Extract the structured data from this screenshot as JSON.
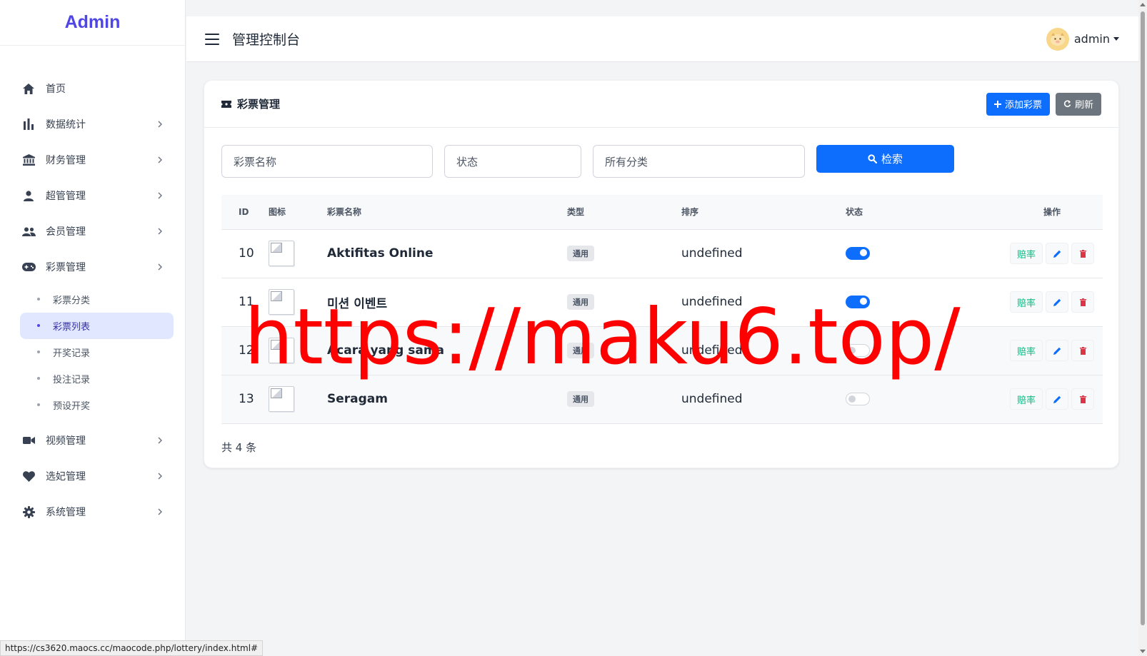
{
  "sidebar": {
    "logo": "Admin",
    "items": [
      {
        "label": "首页",
        "icon": "home-icon"
      },
      {
        "label": "数据统计",
        "icon": "bar-chart-icon"
      },
      {
        "label": "财务管理",
        "icon": "bank-icon"
      },
      {
        "label": "超管管理",
        "icon": "user-icon"
      },
      {
        "label": "会员管理",
        "icon": "users-icon"
      },
      {
        "label": "彩票管理",
        "icon": "gamepad-icon"
      },
      {
        "label": "视频管理",
        "icon": "video-icon"
      },
      {
        "label": "选妃管理",
        "icon": "heart-icon"
      },
      {
        "label": "系统管理",
        "icon": "gear-icon"
      }
    ],
    "subitems": [
      {
        "label": "彩票分类"
      },
      {
        "label": "彩票列表"
      },
      {
        "label": "开奖记录"
      },
      {
        "label": "投注记录"
      },
      {
        "label": "预设开奖"
      }
    ],
    "active_subitem": "彩票列表"
  },
  "header": {
    "title": "管理控制台",
    "username": "admin"
  },
  "card": {
    "title": "彩票管理",
    "add_button": "添加彩票",
    "refresh_button": "刷新"
  },
  "filters": {
    "name_placeholder": "彩票名称",
    "status_placeholder": "状态",
    "category_placeholder": "所有分类",
    "search_button": "检索"
  },
  "table": {
    "headers": [
      "ID",
      "图标",
      "彩票名称",
      "类型",
      "排序",
      "状态",
      "操作"
    ],
    "rows": [
      {
        "id": "10",
        "name": "Aktifitas Online",
        "type": "通用",
        "sort": "undefined",
        "status": true,
        "rate_label": "赔率"
      },
      {
        "id": "11",
        "name": "미션 이벤트",
        "type": "通用",
        "sort": "undefined",
        "status": true,
        "rate_label": "赔率"
      },
      {
        "id": "12",
        "name": "Acara yang sama",
        "type": "通用",
        "sort": "undefined",
        "status": false,
        "rate_label": "赔率"
      },
      {
        "id": "13",
        "name": "Seragam",
        "type": "通用",
        "sort": "undefined",
        "status": false,
        "rate_label": "赔率"
      }
    ]
  },
  "footer": {
    "total": "共 4 条"
  },
  "watermark": "https://maku6.top/",
  "statusbar_url": "https://cs3620.maocs.cc/maocode.php/lottery/index.html#",
  "colors": {
    "accent": "#4f46e5",
    "primary": "#0d6efd",
    "secondary": "#6c757d",
    "success": "#10b981",
    "danger": "#dc3545",
    "watermark": "#ff0000"
  }
}
